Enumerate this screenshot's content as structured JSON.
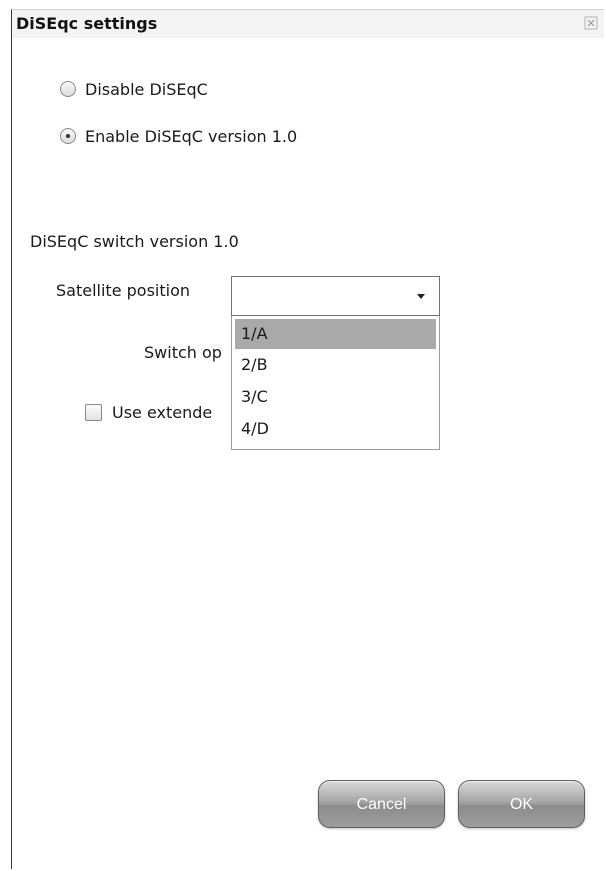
{
  "dialog": {
    "title": "DiSEqc settings",
    "close_icon": "close-icon"
  },
  "mode": {
    "options": [
      {
        "label": "Disable DiSEqC",
        "checked": false
      },
      {
        "label": "Enable DiSEqC version 1.0",
        "checked": true
      }
    ]
  },
  "switch_section": {
    "label": "DiSEqC switch version 1.0",
    "satellite_position_label": "Satellite position",
    "satellite_position_value": "",
    "switch_option_label": "Switch op",
    "use_extended_label": "Use extende",
    "use_extended_checked": false,
    "dropdown_options": [
      "1/A",
      "2/B",
      "3/C",
      "4/D"
    ],
    "dropdown_highlighted": "1/A"
  },
  "buttons": {
    "cancel_label": "Cancel",
    "ok_label": "OK"
  },
  "colors": {
    "highlight": "#a9a9a9",
    "button_gradient_top": "#d9d9d9",
    "button_gradient_bottom": "#9e9e9e"
  }
}
